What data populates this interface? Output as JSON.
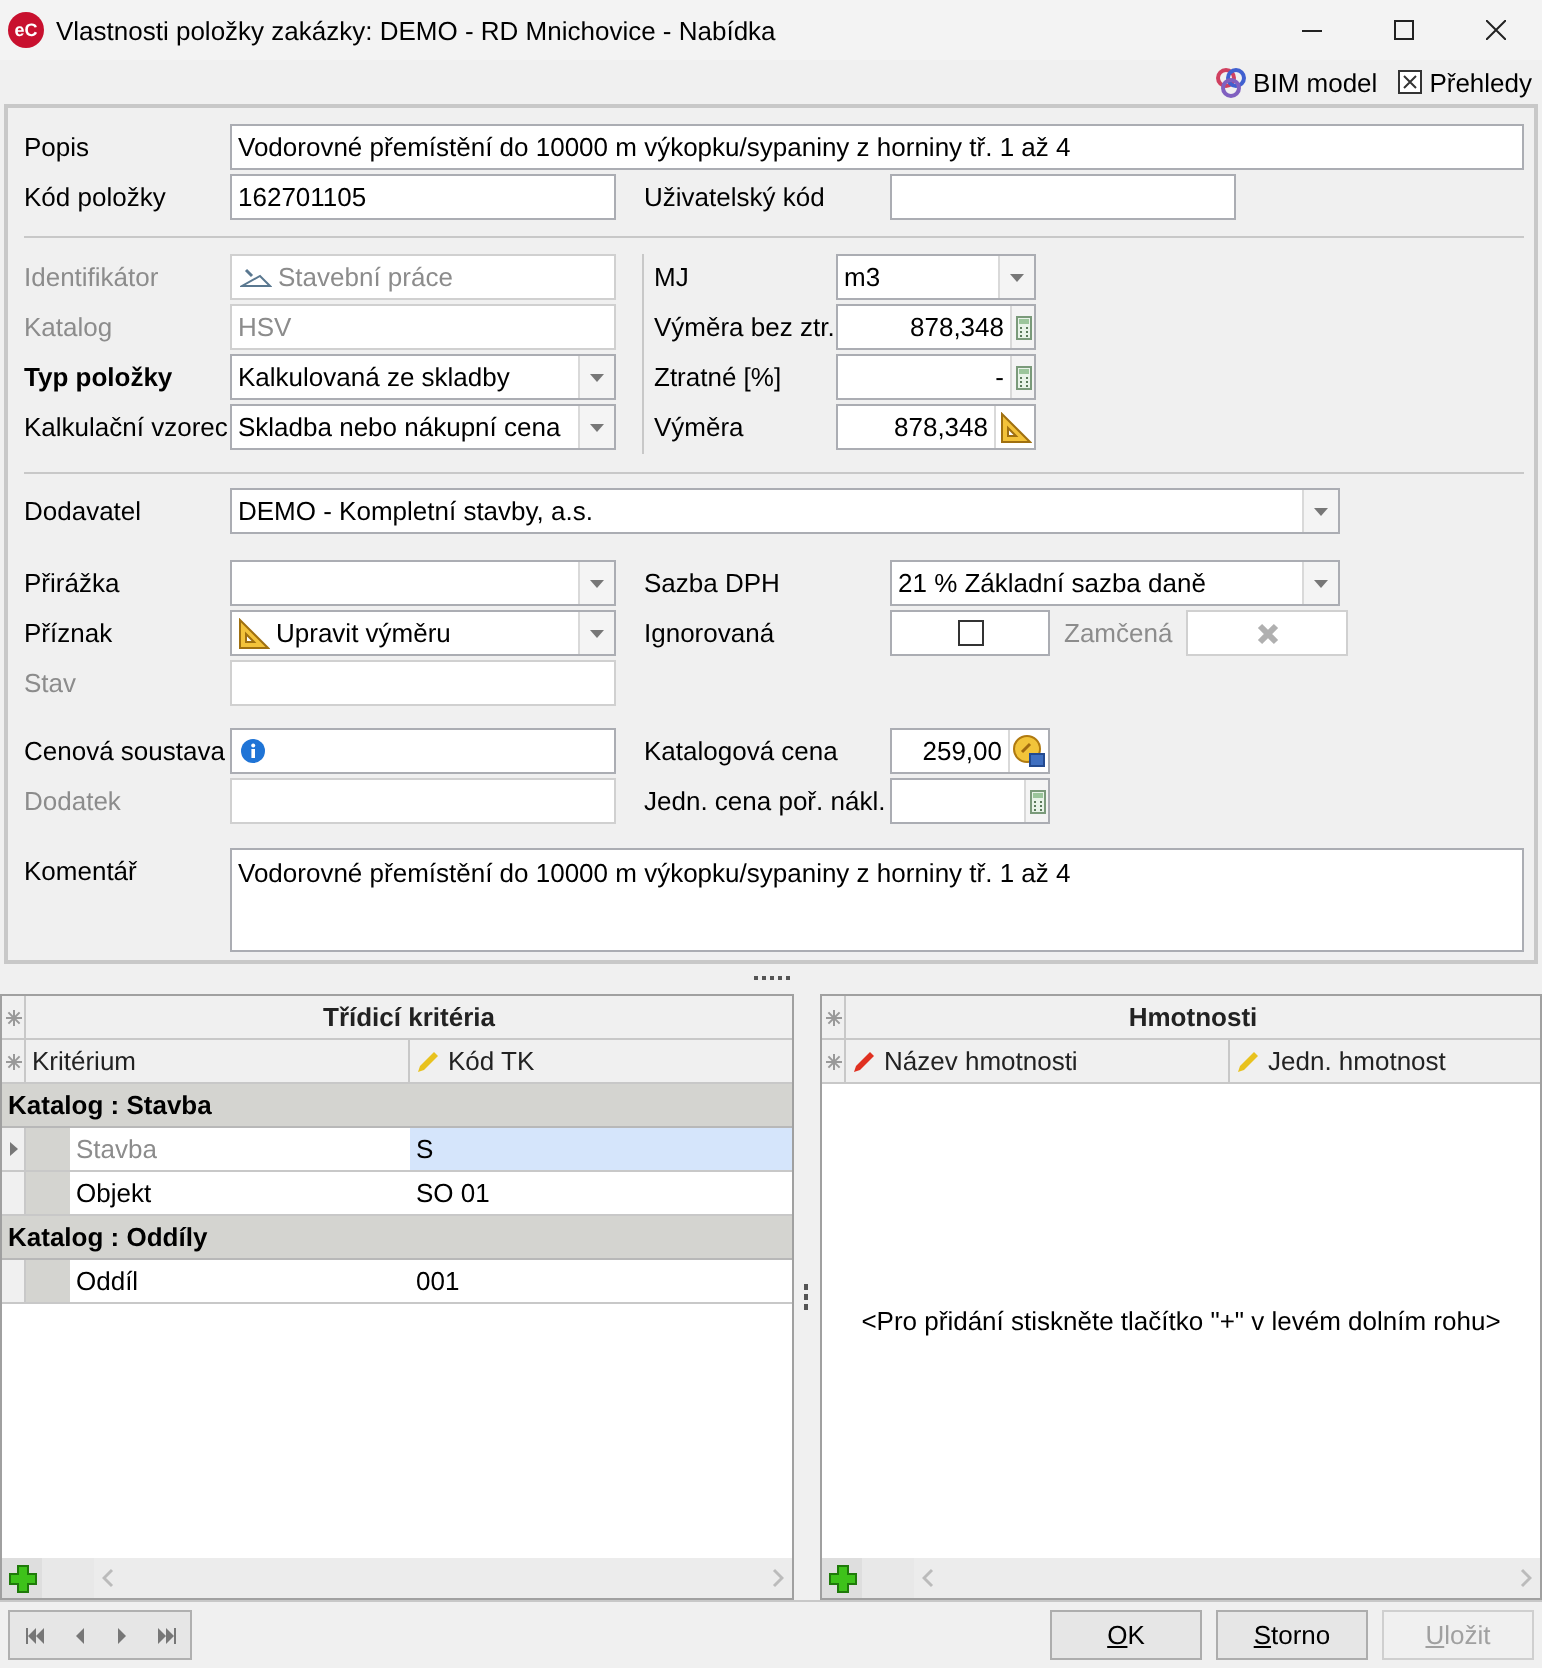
{
  "window": {
    "logo": "eC",
    "title": "Vlastnosti položky zakázky: DEMO - RD Mnichovice - Nabídka"
  },
  "toolbar": [
    {
      "kind": "bim",
      "label": "BIM model"
    },
    {
      "kind": "report",
      "label": "Přehledy"
    }
  ],
  "form": {
    "sections": [
      {
        "kind": "top",
        "rows": [
          [
            {
              "kind": "text",
              "label": "Popis",
              "value": "Vodorovné přemístění do 10000 m výkopku/sypaniny z horniny tř. 1 až 4",
              "disabled": false,
              "required": false
            }
          ],
          [
            {
              "kind": "text",
              "label": "Kód položky",
              "value": "162701105",
              "disabled": false,
              "required": false
            },
            {
              "kind": "text",
              "label": "Uživatelský kód",
              "disabled": false,
              "required": false
            }
          ]
        ]
      },
      {
        "kind": "split",
        "rows": [
          [
            {
              "kind": "text",
              "label": "Identifikátor",
              "value": "Stavební práce",
              "disabled": true,
              "required": false
            },
            {
              "kind": "combo",
              "label": "MJ",
              "value": "m3",
              "disabled": false,
              "required": false
            }
          ],
          [
            {
              "kind": "text",
              "label": "Katalog",
              "value": "HSV",
              "disabled": true,
              "required": false
            },
            {
              "kind": "number",
              "label": "Výměra bez ztr.",
              "value": "878,348",
              "disabled": false,
              "required": false
            }
          ],
          [
            {
              "kind": "combo",
              "label": "Typ položky",
              "value": "Kalkulovaná ze skladby",
              "disabled": false,
              "required": true
            },
            {
              "kind": "number",
              "label": "Ztratné [%]",
              "value": "-",
              "disabled": false,
              "required": false
            }
          ],
          [
            {
              "kind": "combo",
              "label": "Kalkulační vzorec",
              "value": "Skladba nebo nákupní cena",
              "disabled": false,
              "required": false
            },
            {
              "kind": "number",
              "label": "Výměra",
              "value": "878,348",
              "disabled": false,
              "required": false
            }
          ]
        ]
      },
      {
        "kind": "supplier",
        "rows": [
          [
            {
              "kind": "combo",
              "label": "Dodavatel",
              "value": "DEMO - Kompletní stavby, a.s.",
              "disabled": false,
              "required": false
            }
          ]
        ]
      },
      {
        "kind": "flags",
        "rows": [
          [
            {
              "kind": "combo",
              "label": "Přirážka",
              "disabled": false,
              "required": false
            },
            {
              "kind": "combo",
              "label": "Sazba DPH",
              "value": "21 % Základní sazba daně",
              "disabled": false,
              "required": false
            }
          ],
          [
            {
              "kind": "combo",
              "label": "Příznak",
              "value": "Upravit výměru",
              "disabled": false,
              "required": false
            },
            {
              "kind": "check",
              "label": "Ignorovaná",
              "checked": false,
              "disabled": false,
              "required": false
            },
            {
              "kind": "cross",
              "label": "Zamčená",
              "disabled": true,
              "required": false
            }
          ],
          [
            {
              "kind": "text",
              "label": "Stav",
              "disabled": true,
              "required": false
            }
          ]
        ]
      },
      {
        "kind": "prices",
        "rows": [
          [
            {
              "kind": "text",
              "label": "Cenová soustava",
              "disabled": false,
              "required": false
            },
            {
              "kind": "number",
              "label": "Katalogová cena",
              "value": "259,00",
              "disabled": false,
              "required": false
            }
          ],
          [
            {
              "kind": "text",
              "label": "Dodatek",
              "disabled": true,
              "required": false
            },
            {
              "kind": "number",
              "label": "Jedn. cena poř. nákl.",
              "disabled": false,
              "required": false
            }
          ]
        ]
      },
      {
        "kind": "comment",
        "rows": [
          [
            {
              "kind": "memo",
              "label": "Komentář",
              "value": "Vodorovné přemístění do 10000 m výkopku/sypaniny z horniny tř. 1 až 4",
              "disabled": false,
              "required": false
            }
          ]
        ]
      }
    ]
  },
  "criteria_grid": {
    "title": "Třídicí kritéria",
    "columns": [
      {
        "label": "Kritérium"
      },
      {
        "label": "Kód TK",
        "color": "#e8c21e"
      }
    ],
    "groups": [
      {
        "title": "Katalog : Stavba",
        "rows": [
          {
            "cells": [
              "Stavba",
              "S"
            ],
            "selected": true,
            "disabled": true
          },
          {
            "cells": [
              "Objekt",
              "SO 01"
            ],
            "selected": false,
            "disabled": false
          }
        ]
      },
      {
        "title": "Katalog : Oddíly",
        "rows": [
          {
            "cells": [
              "Oddíl",
              "001"
            ],
            "selected": false,
            "disabled": false
          }
        ]
      }
    ]
  },
  "weights_grid": {
    "title": "Hmotnosti",
    "columns": [
      {
        "label": "Název hmotnosti",
        "color": "#e03020"
      },
      {
        "label": "Jedn. hmotnost",
        "color": "#e8c21e"
      }
    ],
    "empty_hint": "<Pro přidání stiskněte tlačítko \"+\" v levém dolním rohu>"
  },
  "buttons": [
    {
      "label": "OK",
      "mnemonic": true,
      "disabled": false
    },
    {
      "label": "Storno",
      "mnemonic": true,
      "disabled": false
    },
    {
      "label": "Uložit",
      "mnemonic": true,
      "disabled": true
    }
  ]
}
